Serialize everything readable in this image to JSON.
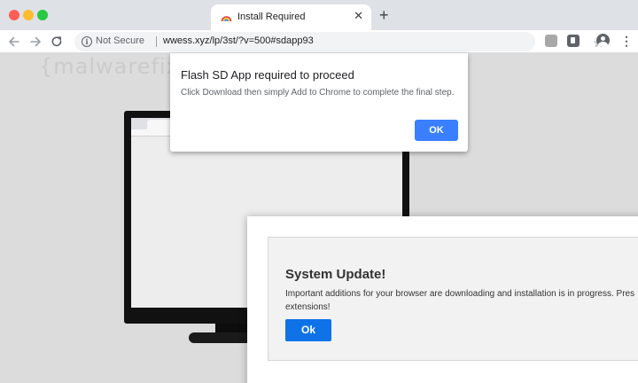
{
  "browser": {
    "tab_title": "Install Required",
    "tab_close_glyph": "✕",
    "new_tab_glyph": "+",
    "security_label": "Not Secure",
    "url": "wwess.xyz/lp/3st/?v=500#sdapp93",
    "icons": [
      "back-arrow-icon",
      "forward-arrow-icon",
      "reload-icon",
      "info-icon",
      "bookmark-star-icon",
      "extension-icon",
      "extension-icon",
      "profile-avatar-icon",
      "kebab-menu-icon"
    ]
  },
  "page": {
    "watermark": "{malwarefixes}"
  },
  "alert_dialog": {
    "title": "Flash SD App required to proceed",
    "message": "Click Download then simply Add to Chrome to complete the final step.",
    "ok_label": "OK"
  },
  "update_panel": {
    "heading": "System Update!",
    "body": "Important additions for your browser are downloading and installation is in progress. Pres\nextensions!",
    "ok_label": "Ok"
  },
  "colors": {
    "tab_strip": "#dee1e6",
    "page_background": "#dcdcdc",
    "dialog_button": "#3a7fff",
    "panel_button": "#0f72e7",
    "close_dot": "#fd5f57",
    "minimize_dot": "#febc2e",
    "zoom_dot": "#28c840"
  }
}
